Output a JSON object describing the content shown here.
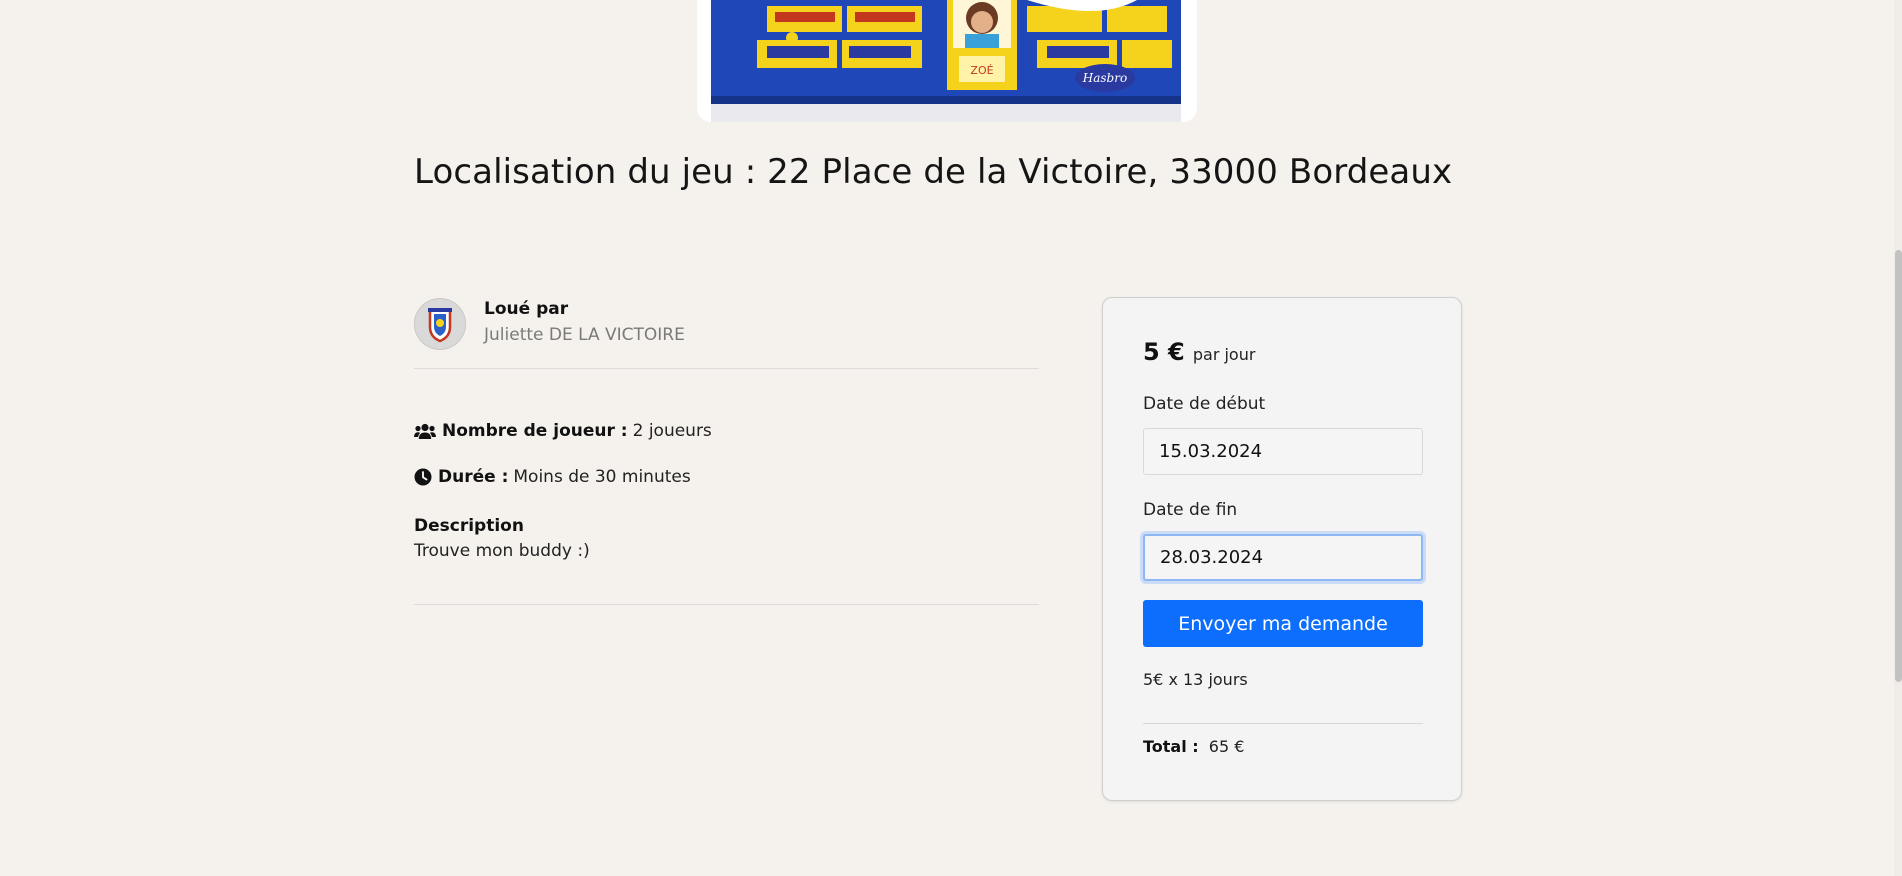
{
  "game": {
    "image_texts": {
      "player_card": "ZOÉ",
      "brand": "Hasbro"
    }
  },
  "location": {
    "title": "Localisation du jeu : 22 Place de la Victoire, 33000 Bordeaux"
  },
  "owner": {
    "label": "Loué par",
    "name": "Juliette DE LA VICTOIRE"
  },
  "details": {
    "players_label": "Nombre de joueur :",
    "players_value": "2 joueurs",
    "duration_label": "Durée :",
    "duration_value": "Moins de 30 minutes",
    "description_title": "Description",
    "description_text": "Trouve mon buddy :)"
  },
  "booking": {
    "price_amount": "5 €",
    "price_unit": "par jour",
    "start_label": "Date de début",
    "start_value": "15.03.2024",
    "end_label": "Date de fin",
    "end_value": "28.03.2024",
    "submit_label": "Envoyer ma demande",
    "calculation": "5€ x 13 jours",
    "total_label": "Total :",
    "total_value": "65 €"
  },
  "icons": {
    "players": "users-icon",
    "duration": "clock-icon",
    "avatar": "shield-avatar-icon"
  },
  "colors": {
    "background": "#f5f2ee",
    "primary_button": "#0d6efd",
    "card_background": "#f4f4f4",
    "muted_text": "#7a7a7a"
  }
}
